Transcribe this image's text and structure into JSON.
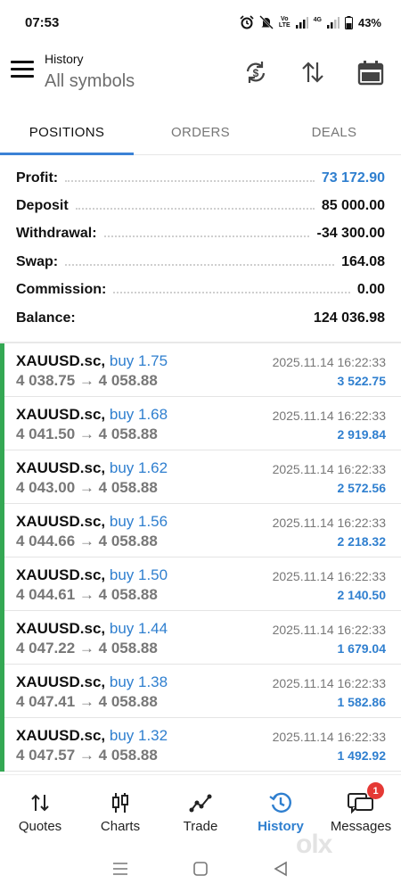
{
  "status_bar": {
    "time": "07:53",
    "network_label_1": "Vo",
    "network_label_2": "LTE",
    "network_label_3": "4G",
    "battery": "43%"
  },
  "header": {
    "title": "History",
    "subtitle": "All symbols"
  },
  "tabs": [
    {
      "label": "POSITIONS",
      "active": true
    },
    {
      "label": "ORDERS",
      "active": false
    },
    {
      "label": "DEALS",
      "active": false
    }
  ],
  "summary": [
    {
      "label": "Profit:",
      "value": "73 172.90"
    },
    {
      "label": "Deposit",
      "value": "85 000.00"
    },
    {
      "label": "Withdrawal:",
      "value": "-34 300.00"
    },
    {
      "label": "Swap:",
      "value": "164.08"
    },
    {
      "label": "Commission:",
      "value": "0.00"
    },
    {
      "label": "Balance:",
      "value": "124 036.98"
    }
  ],
  "deals": [
    {
      "symbol": "XAUUSD.sc,",
      "side": "buy 1.75",
      "open": "4 038.75",
      "arrow": "→",
      "close": "4 058.88",
      "time": "2025.11.14 16:22:33",
      "profit": "3 522.75"
    },
    {
      "symbol": "XAUUSD.sc,",
      "side": "buy 1.68",
      "open": "4 041.50",
      "arrow": "→",
      "close": "4 058.88",
      "time": "2025.11.14 16:22:33",
      "profit": "2 919.84"
    },
    {
      "symbol": "XAUUSD.sc,",
      "side": "buy 1.62",
      "open": "4 043.00",
      "arrow": "→",
      "close": "4 058.88",
      "time": "2025.11.14 16:22:33",
      "profit": "2 572.56"
    },
    {
      "symbol": "XAUUSD.sc,",
      "side": "buy 1.56",
      "open": "4 044.66",
      "arrow": "→",
      "close": "4 058.88",
      "time": "2025.11.14 16:22:33",
      "profit": "2 218.32"
    },
    {
      "symbol": "XAUUSD.sc,",
      "side": "buy 1.50",
      "open": "4 044.61",
      "arrow": "→",
      "close": "4 058.88",
      "time": "2025.11.14 16:22:33",
      "profit": "2 140.50"
    },
    {
      "symbol": "XAUUSD.sc,",
      "side": "buy 1.44",
      "open": "4 047.22",
      "arrow": "→",
      "close": "4 058.88",
      "time": "2025.11.14 16:22:33",
      "profit": "1 679.04"
    },
    {
      "symbol": "XAUUSD.sc,",
      "side": "buy 1.38",
      "open": "4 047.41",
      "arrow": "→",
      "close": "4 058.88",
      "time": "2025.11.14 16:22:33",
      "profit": "1 582.86"
    },
    {
      "symbol": "XAUUSD.sc,",
      "side": "buy 1.32",
      "open": "4 047.57",
      "arrow": "→",
      "close": "4 058.88",
      "time": "2025.11.14 16:22:33",
      "profit": "1 492.92"
    }
  ],
  "bottom_nav": [
    {
      "label": "Quotes",
      "icon": "quotes-arrows-icon",
      "active": false
    },
    {
      "label": "Charts",
      "icon": "candlestick-icon",
      "active": false
    },
    {
      "label": "Trade",
      "icon": "trend-line-icon",
      "active": false
    },
    {
      "label": "History",
      "icon": "history-clock-icon",
      "active": true
    },
    {
      "label": "Messages",
      "icon": "chat-bubble-icon",
      "active": false,
      "badge": "1"
    }
  ],
  "watermark": "olx",
  "colors": {
    "accent_blue": "#2f7fcf",
    "deal_stripe_green": "#34a853",
    "badge_red": "#e53935"
  }
}
